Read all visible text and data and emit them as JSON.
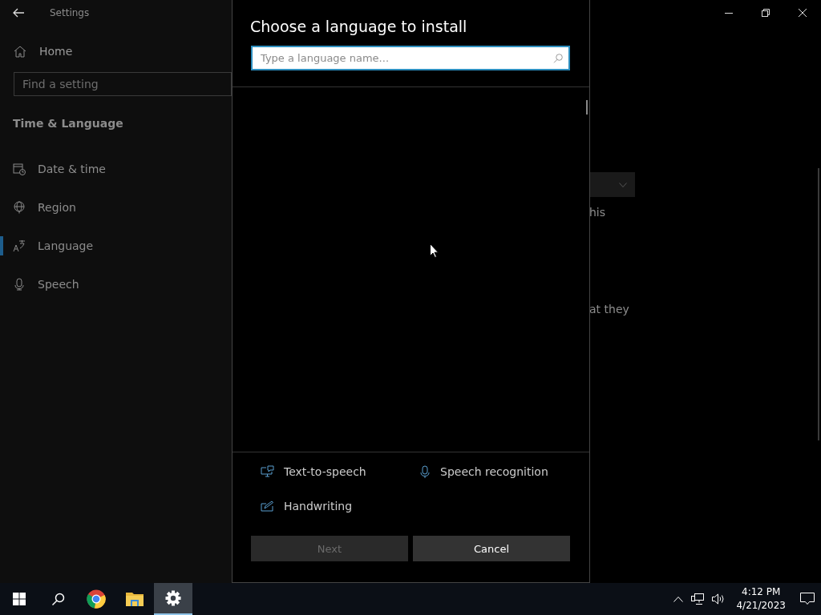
{
  "window": {
    "title": "Settings"
  },
  "sidebar": {
    "home": "Home",
    "search": {
      "placeholder": "Find a setting"
    },
    "section": "Time & Language",
    "items": [
      {
        "label": "Date & time",
        "kind": "calendar",
        "selected": false
      },
      {
        "label": "Region",
        "kind": "globe",
        "selected": false
      },
      {
        "label": "Language",
        "kind": "language",
        "selected": true
      },
      {
        "label": "Speech",
        "kind": "microphone",
        "selected": false
      }
    ]
  },
  "main": {
    "fragments": [
      "his",
      "at they"
    ]
  },
  "dialog": {
    "title": "Choose a language to install",
    "search": {
      "placeholder": "Type a language name..."
    },
    "features": [
      {
        "label": "Text-to-speech",
        "kind": "tts"
      },
      {
        "label": "Speech recognition",
        "kind": "speech"
      },
      {
        "label": "Handwriting",
        "kind": "handwriting"
      }
    ],
    "buttons": [
      {
        "label": "Next",
        "disabled": true
      },
      {
        "label": "Cancel",
        "disabled": false
      }
    ]
  },
  "taskbar": {
    "apps": [
      {
        "kind": "start",
        "selected": false
      },
      {
        "kind": "search",
        "selected": false
      },
      {
        "kind": "browser",
        "selected": false
      },
      {
        "kind": "folder",
        "selected": false
      },
      {
        "kind": "settings",
        "selected": true
      }
    ],
    "time": "4:12 PM",
    "date": "4/21/2023"
  }
}
